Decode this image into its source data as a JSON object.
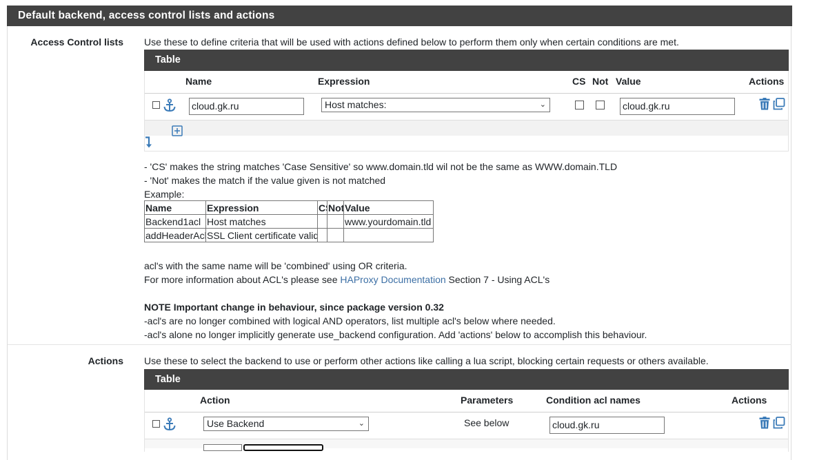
{
  "panel": {
    "title": "Default backend, access control lists and actions"
  },
  "acl": {
    "label": "Access Control lists",
    "help": "Use these to define criteria that will be used with actions defined below to perform them only when certain conditions are met.",
    "table_title": "Table",
    "columns": {
      "name": "Name",
      "expression": "Expression",
      "cs": "CS",
      "not": "Not",
      "value": "Value",
      "actions": "Actions"
    },
    "row": {
      "name": "cloud.gk.ru",
      "expression": "Host matches:",
      "value": "cloud.gk.ru"
    },
    "notes": [
      "- 'CS' makes the string matches 'Case Sensitive' so www.domain.tld wil not be the same as WWW.domain.TLD",
      "- 'Not' makes the match if the value given is not matched",
      "Example:"
    ],
    "example": {
      "header": [
        "Name",
        "Expression",
        "CS",
        "Not",
        "Value"
      ],
      "rows": [
        [
          "Backend1acl",
          "Host matches",
          "",
          "",
          "www.yourdomain.tld"
        ],
        [
          "addHeaderAcl",
          "SSL Client certificate valid",
          "",
          "",
          ""
        ]
      ]
    },
    "combined_note": "acl's with the same name will be 'combined' using OR criteria.",
    "info_prefix": "For more information about ACL's please see ",
    "info_link": "HAProxy Documentation",
    "info_suffix": " Section 7 - Using ACL's",
    "note_title": "NOTE Important change in behaviour, since package version 0.32",
    "note_lines": [
      "-acl's are no longer combined with logical AND operators, list multiple acl's below where needed.",
      "-acl's alone no longer implicitly generate use_backend configuration. Add 'actions' below to accomplish this behaviour."
    ]
  },
  "actions": {
    "label": "Actions",
    "help": "Use these to select the backend to use or perform other actions like calling a lua script, blocking certain requests or others available.",
    "table_title": "Table",
    "columns": {
      "action": "Action",
      "parameters": "Parameters",
      "condition": "Condition acl names",
      "actions": "Actions"
    },
    "row": {
      "action": "Use Backend",
      "parameters": "See below",
      "condition": "cloud.gk.ru"
    }
  },
  "icons": {
    "anchor": "anchor-icon",
    "trash": "trash-icon",
    "duplicate": "duplicate-icon",
    "add": "plus-square-icon",
    "move": "arrow-down-icon"
  },
  "colors": {
    "header_bg": "#424242",
    "link": "#3c6fa5",
    "icon": "#3b7bb8"
  }
}
